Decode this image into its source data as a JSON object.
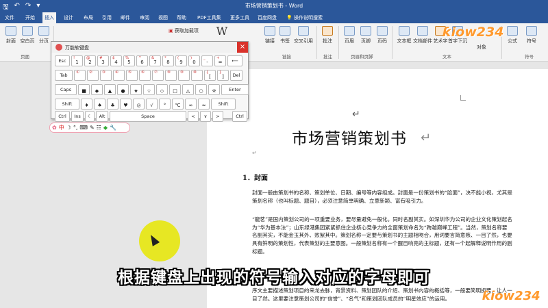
{
  "window": {
    "title": "市场营销策划书 - Word",
    "quick_access": [
      "save-icon",
      "undo-icon",
      "redo-icon",
      "customize-icon"
    ]
  },
  "tabs": [
    "文件",
    "开始",
    "插入",
    "设计",
    "布局",
    "引用",
    "邮件",
    "审阅",
    "视图",
    "帮助",
    "PDF工具集",
    "更多工具",
    "百度网盘"
  ],
  "active_tab": "插入",
  "tell_me": "操作说明搜索",
  "ribbon": {
    "buttons": [
      {
        "label": "封面",
        "icon": "cover-page-icon"
      },
      {
        "label": "空白页",
        "icon": "blank-page-icon"
      },
      {
        "label": "分页",
        "icon": "page-break-icon"
      },
      {
        "label": "获取加载项",
        "icon": "store-icon"
      },
      {
        "label": "链接",
        "icon": "link-icon"
      },
      {
        "label": "书签",
        "icon": "bookmark-icon"
      },
      {
        "label": "交叉引用",
        "icon": "cross-ref-icon"
      },
      {
        "label": "批注",
        "icon": "comment-icon"
      },
      {
        "label": "页眉",
        "icon": "header-icon"
      },
      {
        "label": "页脚",
        "icon": "footer-icon"
      },
      {
        "label": "页码",
        "icon": "page-number-icon"
      },
      {
        "label": "文本框",
        "icon": "textbox-icon"
      },
      {
        "label": "文档部件",
        "icon": "quick-parts-icon"
      },
      {
        "label": "艺术字",
        "icon": "wordart-icon"
      },
      {
        "label": "首字下沉",
        "icon": "dropcap-icon"
      },
      {
        "label": "公式",
        "icon": "equation-icon"
      },
      {
        "label": "符号",
        "icon": "symbol-icon"
      }
    ],
    "groups": [
      "页面",
      "链接",
      "批注",
      "页眉和页脚",
      "文本",
      "符号"
    ],
    "extra": "对象"
  },
  "keyboard": {
    "title": "万能软键盘",
    "close": "×",
    "rows": [
      [
        {
          "t": "Esc"
        },
        {
          "u": "!",
          "d": "1"
        },
        {
          "u": "@",
          "d": "2"
        },
        {
          "u": "#",
          "d": "3"
        },
        {
          "u": "$",
          "d": "4"
        },
        {
          "u": "%",
          "d": "5"
        },
        {
          "u": "^",
          "d": "6"
        },
        {
          "u": "&",
          "d": "7"
        },
        {
          "u": "*",
          "d": "8"
        },
        {
          "u": "(",
          "d": "9"
        },
        {
          "u": ")",
          "d": "0"
        },
        {
          "u": "_",
          "d": "-"
        },
        {
          "u": "+",
          "d": "="
        },
        {
          "t": "⟵"
        }
      ],
      [
        {
          "t": "Tab"
        },
        {
          "u": "①",
          "d": ""
        },
        {
          "u": "②",
          "d": ""
        },
        {
          "u": "③",
          "d": ""
        },
        {
          "u": "④",
          "d": ""
        },
        {
          "u": "⑤",
          "d": ""
        },
        {
          "u": "⑥",
          "d": ""
        },
        {
          "u": "⑦",
          "d": ""
        },
        {
          "u": "⑧",
          "d": ""
        },
        {
          "u": "⑨",
          "d": ""
        },
        {
          "u": "⑩",
          "d": ""
        },
        {
          "u": "{",
          "d": "["
        },
        {
          "u": "}",
          "d": "]"
        },
        {
          "t": "Del"
        }
      ],
      [
        {
          "t": "Caps"
        },
        {
          "u": "",
          "d": "■"
        },
        {
          "u": "",
          "d": "◆"
        },
        {
          "u": "",
          "d": "▲"
        },
        {
          "u": "",
          "d": "●"
        },
        {
          "u": "",
          "d": "★"
        },
        {
          "u": "",
          "d": "☆"
        },
        {
          "u": "",
          "d": "◇"
        },
        {
          "u": "",
          "d": "□"
        },
        {
          "u": "",
          "d": "△"
        },
        {
          "u": "",
          "d": "○"
        },
        {
          "u": "",
          "d": "※"
        },
        {
          "t": "Enter"
        }
      ],
      [
        {
          "t": "Shift"
        },
        {
          "u": "",
          "d": "♦"
        },
        {
          "u": "",
          "d": "♠"
        },
        {
          "u": "",
          "d": "♣"
        },
        {
          "u": "",
          "d": "♥"
        },
        {
          "u": "",
          "d": "◎"
        },
        {
          "u": "",
          "d": "√"
        },
        {
          "u": "",
          "d": "°"
        },
        {
          "u": "",
          "d": "℃"
        },
        {
          "u": "",
          "d": "∞"
        },
        {
          "u": "",
          "d": "≈"
        },
        {
          "t": "Shift"
        }
      ],
      [
        {
          "t": "Ctrl"
        },
        {
          "t": "Ins"
        },
        {
          "t": "☾"
        },
        {
          "t": "Alt"
        },
        {
          "t": "Space"
        },
        {
          "t": "<"
        },
        {
          "t": "∨"
        },
        {
          "t": ">"
        },
        {
          "t": "Ctrl"
        }
      ]
    ]
  },
  "ime_toolbar": [
    "中",
    "☽",
    "°,",
    "⌨",
    "✎",
    "☷",
    "◆",
    "✿",
    "🔧"
  ],
  "document": {
    "title": "市场营销策划书",
    "heading1": "1．封面",
    "para1": "封面一般由策划书的名称、策划单位、日期、编号等内容组成。封面是一份策划书的“脸面”，决不能小视，尤其是策划名称（也叫标题、题目），必须注意简单明确、立意新颖、富有吸引力。",
    "para2": "“龍茗”是国内策划公司的一项重要业务，要尽量避免一般化。同时名副其实。如深圳华为公司的企业文化策划起名为“华为基本法”；山东绿港集团紧紧抓住企业核心竞争力的全面策划命名为“跨越巅峰工程”。当然，策划名称要名副其实，不能金玉其外、败絮其中。策划名称一定要与策划书的主题相吻合，用词要言简意赅、一目了然，也要具有鲜明的策划性，代表策划的主要意图。一般策划名称有一个醒目响亮的主标题，还有一个起解释说明作用的副标题。",
    "para3": "序文主要描述策划项目的来龙去脉，背景资料、策划团队的介绍、策划书内容的概括等，一般要简明扼要，让人一目了然。这里要注意策划公司的“信誉”、“名气”和策划团队成员的“明星效应”的运用。"
  },
  "subtitle": "根据键盘上出现的符号输入对应的字母即可",
  "watermark": "ƙiow234",
  "colors": {
    "titlebar": "#2b579a",
    "close_red": "#d9322b",
    "highlight": "#e6e600",
    "watermark": "#ff9a2e"
  }
}
